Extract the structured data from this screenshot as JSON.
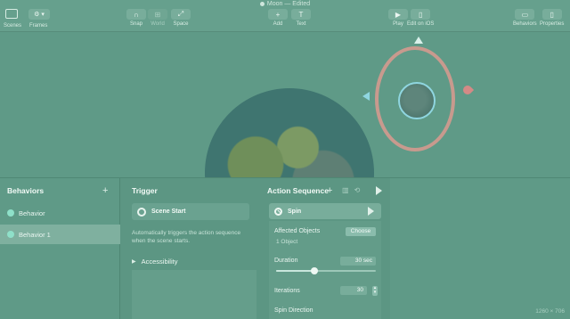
{
  "window": {
    "title": "Moon — Edited"
  },
  "toolbar": {
    "scenes_label": "Scenes",
    "frames_label": "Frames",
    "frame_button": "⚙ ▾",
    "snap_label": "Snap",
    "world_label": "World",
    "space_label": "Space",
    "add_label": "Add",
    "text_label": "Text",
    "play_label": "Play",
    "edit_ios_label": "Edit on iOS",
    "behaviors_label": "Behaviors",
    "properties_label": "Properties"
  },
  "behaviors": {
    "title": "Behaviors",
    "add": "+",
    "items": [
      {
        "label": "Behavior"
      },
      {
        "label": "Behavior 1"
      }
    ]
  },
  "trigger": {
    "title": "Trigger",
    "card_title": "Scene Start",
    "description": "Automatically triggers the action sequence when the scene starts.",
    "accessibility": "Accessibility"
  },
  "action_sequence": {
    "title": "Action Sequence",
    "add": "+",
    "spin": {
      "title": "Spin",
      "affected_objects_label": "Affected Objects",
      "choose_label": "Choose",
      "object_count": "1 Object",
      "duration_label": "Duration",
      "duration_value": "30 sec",
      "duration_slider_fraction": 0.38,
      "iterations_label": "Iterations",
      "iterations_value": "30",
      "spin_direction_label": "Spin Direction"
    }
  },
  "status": {
    "resolution": "1260 × 706"
  },
  "colors": {
    "overlay": "#5f9a87",
    "selected_row": "#7fb09f",
    "behavior_dot": "#8fe0c9",
    "moon_ring": "#c89a8e",
    "moon_highlight": "#8fd6e0"
  }
}
